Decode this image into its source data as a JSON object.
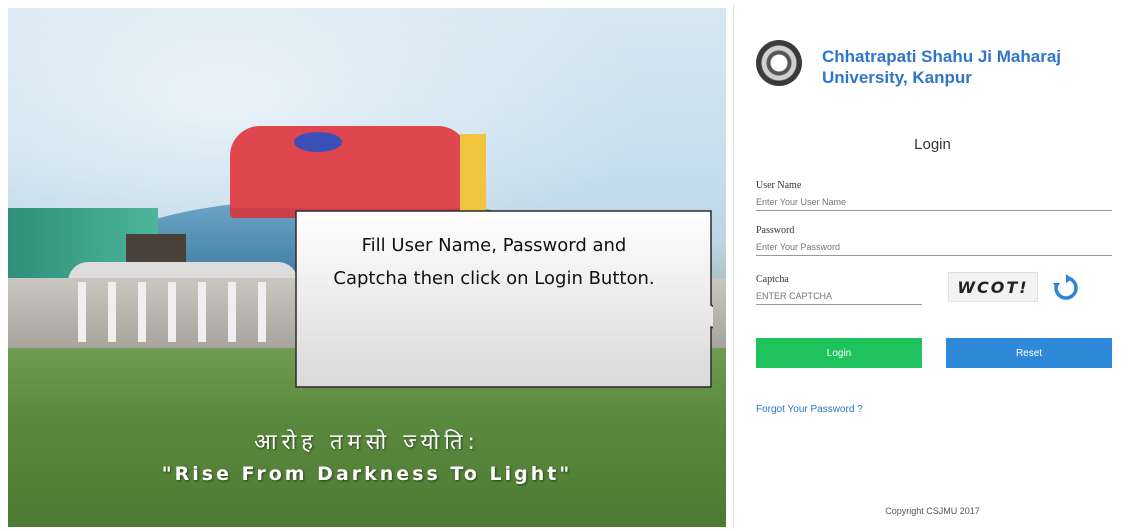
{
  "hero": {
    "motto_hindi": "आरोह तमसो ज्योति:",
    "motto_english": "\"Rise From Darkness To Light\""
  },
  "callout": {
    "text": "Fill User Name, Password and Captcha then click on Login Button."
  },
  "panel": {
    "university_name": "Chhatrapati Shahu Ji Maharaj University, Kanpur",
    "login_title": "Login",
    "username": {
      "label": "User Name",
      "placeholder": "Enter Your User Name"
    },
    "password": {
      "label": "Password",
      "placeholder": "Enter Your Password"
    },
    "captcha": {
      "label": "Captcha",
      "placeholder": "ENTER CAPTCHA",
      "image_text": "WCOT!"
    },
    "login_button": "Login",
    "reset_button": "Reset",
    "forgot_link": "Forgot Your Password ?",
    "copyright": "Copyright CSJMU 2017"
  },
  "colors": {
    "brand_blue": "#2f76c9",
    "login_green": "#1ec35e",
    "reset_blue": "#2f89d9",
    "hero_red": "#e0464e"
  },
  "icons": {
    "refresh": "refresh-icon",
    "logo": "university-logo"
  }
}
